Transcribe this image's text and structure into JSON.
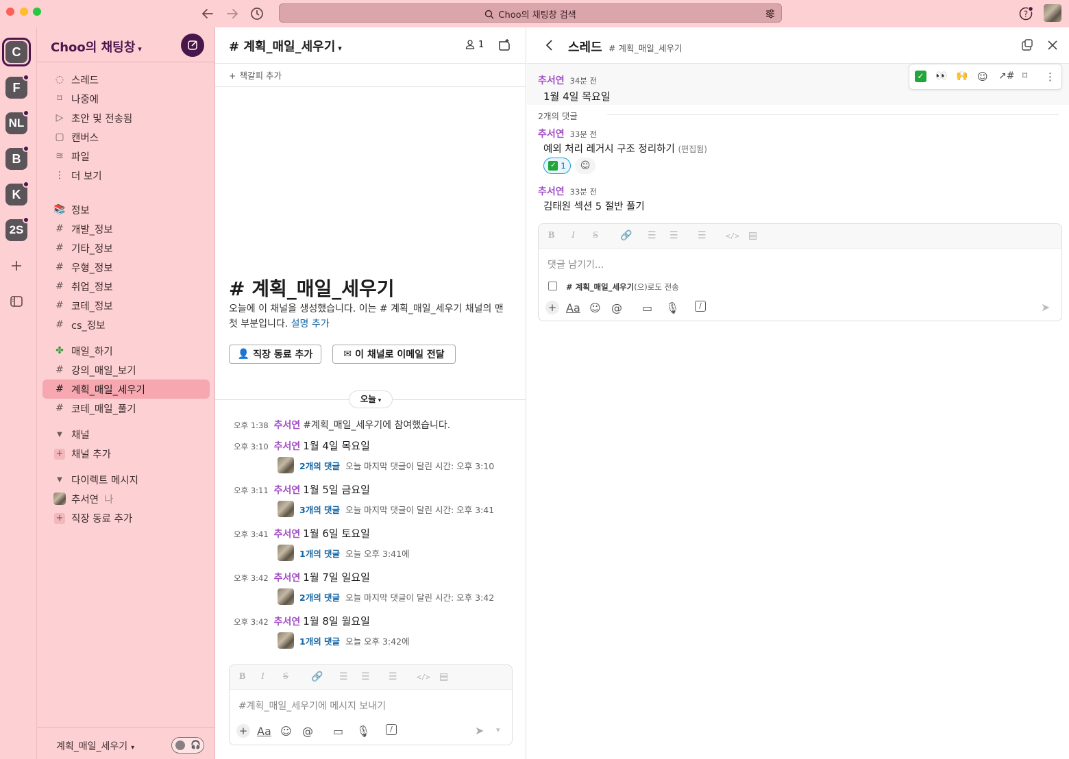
{
  "titlebar": {
    "search_text": "Choo의 채팅창 검색"
  },
  "rail": {
    "workspaces": [
      "C",
      "F",
      "NL",
      "B",
      "K",
      "2S"
    ]
  },
  "sidebar": {
    "workspace_name": "Choo의 채팅창",
    "top_items": [
      {
        "label": "스레드",
        "icon": "threads-icon"
      },
      {
        "label": "나중에",
        "icon": "bookmark-icon"
      },
      {
        "label": "초안 및 전송됨",
        "icon": "send-icon"
      },
      {
        "label": "캔버스",
        "icon": "canvas-icon"
      },
      {
        "label": "파일",
        "icon": "files-icon"
      },
      {
        "label": "더 보기",
        "icon": "more-icon"
      }
    ],
    "channels_group1": [
      "정보",
      "개발_정보",
      "기타_정보",
      "우형_정보",
      "취업_정보",
      "코테_정보",
      "cs_정보"
    ],
    "channels_group2": [
      "매일_하기",
      "강의_매일_보기",
      "계획_매일_세우기",
      "코테_매일_풀기"
    ],
    "active_channel": "계획_매일_세우기",
    "section_channels": "채널",
    "add_channel": "채널 추가",
    "section_dm": "다이렉트 메시지",
    "dm_user": "추서연",
    "dm_me": "나",
    "add_coworker": "직장 동료 추가",
    "footer_channel": "계획_매일_세우기"
  },
  "channel": {
    "header_title": "# 계획_매일_세우기",
    "member_count": "1",
    "add_bookmark": "책갈피 추가",
    "intro_title": "# 계획_매일_세우기",
    "intro_text": "오늘에 이 채널을 생성했습니다. 이는 # 계획_매일_세우기 채널의 맨 첫 부분입니다.",
    "intro_link": "설명 추가",
    "add_coworker_btn": "직장 동료 추가",
    "email_btn": "이 채널로 이메일 전달",
    "date_divider": "오늘",
    "join_message": {
      "time": "오후 1:38",
      "user": "추서연",
      "text": "#계획_매일_세우기에 참여했습니다."
    },
    "messages": [
      {
        "time": "오후 3:10",
        "user": "추서연",
        "text": "1월 4일 목요일",
        "replies": "2개의 댓글",
        "reply_meta": "오늘 마지막 댓글이 달린 시간: 오후 3:10"
      },
      {
        "time": "오후 3:11",
        "user": "추서연",
        "text": "1월 5일 금요일",
        "replies": "3개의 댓글",
        "reply_meta": "오늘 마지막 댓글이 달린 시간: 오후 3:41"
      },
      {
        "time": "오후 3:41",
        "user": "추서연",
        "text": "1월 6일 토요일",
        "replies": "1개의 댓글",
        "reply_meta": "오늘 오후 3:41에"
      },
      {
        "time": "오후 3:42",
        "user": "추서연",
        "text": "1월 7일 일요일",
        "replies": "2개의 댓글",
        "reply_meta": "오늘 마지막 댓글이 달린 시간: 오후 3:42"
      },
      {
        "time": "오후 3:42",
        "user": "추서연",
        "text": "1월 8일 월요일",
        "replies": "1개의 댓글",
        "reply_meta": "오늘 오후 3:42에"
      }
    ],
    "composer_placeholder": "#계획_매일_세우기에 메시지 보내기"
  },
  "thread": {
    "title": "스레드",
    "channel": "# 계획_매일_세우기",
    "parent": {
      "user": "추서연",
      "time": "34분 전",
      "text": "1월 4일 목요일"
    },
    "reply_count": "2개의 댓글",
    "replies": [
      {
        "user": "추서연",
        "time": "33분 전",
        "text": "예외 처리 레거시 구조 정리하기",
        "edited": "(편집됨)",
        "reaction_count": "1"
      },
      {
        "user": "추서연",
        "time": "33분 전",
        "text": "김태원 섹션 5 절반 풀기"
      }
    ],
    "composer_placeholder": "댓글 남기기...",
    "also_send_channel": "# 계획_매일_세우기",
    "also_send_suffix": "(으)로도 전송"
  },
  "colors": {
    "titlebar_bg": "#fdd1d3",
    "sidebar_bg": "#fdd1d3",
    "active_item_bg": "#f7a7af",
    "name_color": "#a34ec6",
    "link_color": "#1264a3",
    "workspace_active": "#4a154b"
  }
}
